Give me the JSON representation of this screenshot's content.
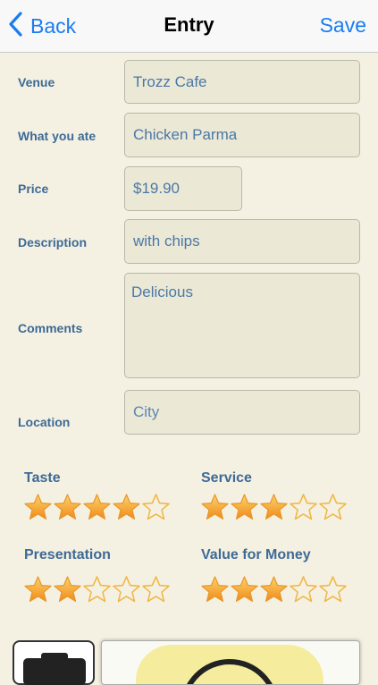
{
  "nav": {
    "back_label": "Back",
    "title": "Entry",
    "save_label": "Save"
  },
  "form": {
    "venue": {
      "label": "Venue",
      "value": "Trozz Cafe"
    },
    "ate": {
      "label": "What you ate",
      "value": "Chicken Parma"
    },
    "price": {
      "label": "Price",
      "value": "$19.90"
    },
    "description": {
      "label": "Description",
      "value": "with chips"
    },
    "comments": {
      "label": "Comments",
      "value": "Delicious"
    },
    "location": {
      "label": "Location",
      "placeholder": "City"
    }
  },
  "ratings": {
    "taste": {
      "label": "Taste",
      "value": 4,
      "max": 5
    },
    "service": {
      "label": "Service",
      "value": 3,
      "max": 5
    },
    "presentation": {
      "label": "Presentation",
      "value": 2,
      "max": 5
    },
    "value_for_money": {
      "label": "Value for Money",
      "value": 3,
      "max": 5
    }
  },
  "colors": {
    "accent": "#1a7cf0",
    "label": "#3d6a96",
    "star_fill": "#f5a623",
    "star_outline": "#f0b84a"
  }
}
